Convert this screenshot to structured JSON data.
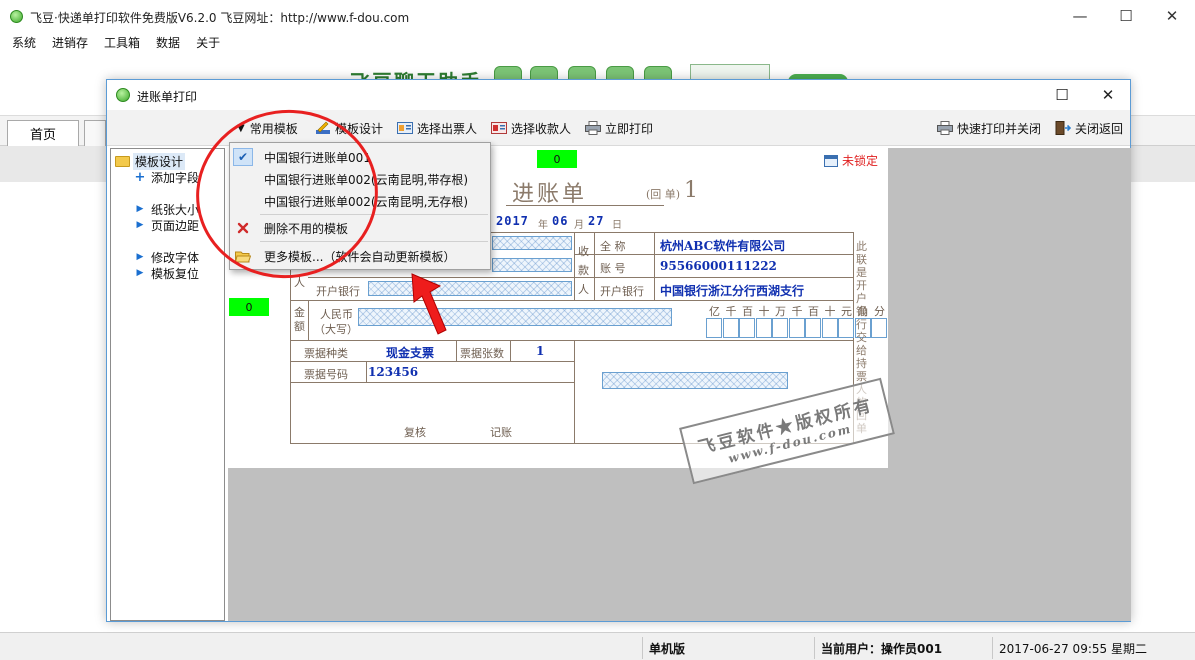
{
  "window": {
    "title": "飞豆·快递单打印软件免费版V6.2.0   飞豆网址：http://www.f-dou.com",
    "minimize_label": "—",
    "maximize_label": "☐",
    "close_label": "✕"
  },
  "menubar": {
    "items": [
      {
        "label": "系统"
      },
      {
        "label": "进销存"
      },
      {
        "label": "工具箱"
      },
      {
        "label": "数据"
      },
      {
        "label": "关于"
      }
    ]
  },
  "banner": {
    "text": "飞豆聊天助手"
  },
  "tabs": {
    "home_label": "首页"
  },
  "statusbar": {
    "mode": "单机版",
    "user": "当前用户：操作员001",
    "datetime": "2017-06-27 09:55 星期二"
  },
  "dialog": {
    "title": "进账单打印",
    "maximize_label": "☐",
    "close_label": "✕",
    "toolbar": {
      "common_templates": "常用模板",
      "template_design": "模板设计",
      "select_drawer": "选择出票人",
      "select_payee": "选择收款人",
      "print_now": "立即打印",
      "quick_print_close": "快速打印并关闭",
      "close_return": "关闭返回"
    },
    "tree": {
      "root": "模板设计",
      "add_field": "添加字段",
      "paper_size": "纸张大小",
      "page_margin": "页面边距",
      "modify_font": "修改字体",
      "template_reset": "模板复位"
    },
    "dropdown": {
      "items": [
        {
          "label": "中国银行进账单001",
          "checked": true
        },
        {
          "label": "中国银行进账单002(云南昆明,带存根)"
        },
        {
          "label": "中国银行进账单002(云南昆明,无存根)"
        },
        {
          "label": "删除不用的模板"
        },
        {
          "label": "更多模板...（软件会自动更新模板）"
        }
      ]
    },
    "canvas": {
      "green_tag_top": "0",
      "green_tag_left": "0",
      "lock_status": "未锁定",
      "slip": {
        "title": "进账单",
        "title_sub": "(回   单)",
        "number": "1",
        "date_year": "2017",
        "date_month": "06",
        "date_day": "27",
        "year_label": "年",
        "month_label": "月",
        "day_label": "日",
        "payee_section_label": "收款人",
        "full_name_label": "全    称",
        "full_name_value": "杭州ABC软件有限公司",
        "account_label": "账    号",
        "account_value": "95566000111222",
        "bank_label": "开户银行",
        "bank_value": "中国银行浙江分行西湖支行",
        "drawer_bank_label": "开户银行",
        "drawer_section_label": "人",
        "amount_label": "金额",
        "rmb_label": "人民币",
        "rmb_sub_label": "（大写）",
        "digit_headers": [
          "亿",
          "千",
          "百",
          "十",
          "万",
          "千",
          "百",
          "十",
          "元",
          "角",
          "分"
        ],
        "bill_type_label": "票据种类",
        "bill_type_value": "现金支票",
        "bill_count_label": "票据张数",
        "bill_count_value": "1",
        "bill_number_label": "票据号码",
        "bill_number_value": "123456",
        "review_label": "复核",
        "bookkeep_label": "记账",
        "side_text": "此联是开户银行交给持票人的回单",
        "watermark_line1": "飞豆软件★版权所有",
        "watermark_line2": "www.f-dou.com"
      }
    }
  },
  "colors": {
    "accent": "#5b9bd5",
    "green_tag": "#00ff00",
    "annotation_red": "#e82020",
    "slip_value_blue": "#1030b0",
    "lock_red": "#e02020"
  }
}
